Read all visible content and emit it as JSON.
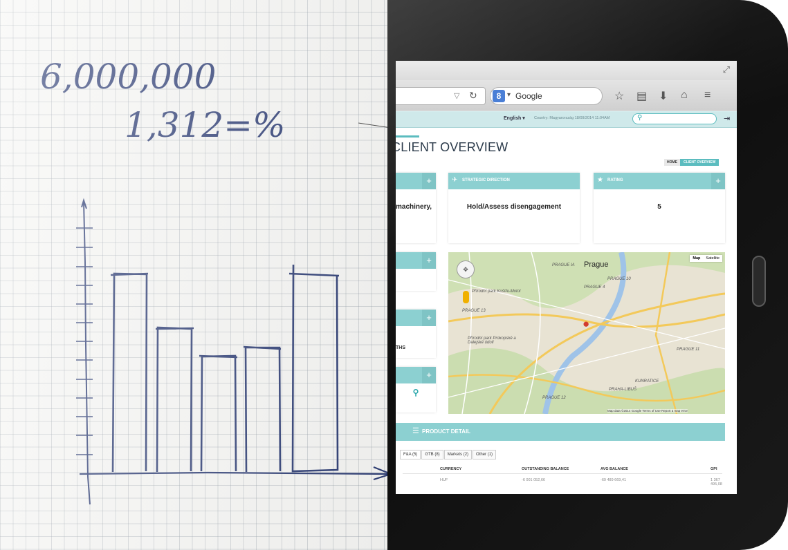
{
  "notebook": {
    "number": "6,000,000",
    "formula": "1,312=%"
  },
  "browser": {
    "search_engine": "Google"
  },
  "site": {
    "language": "English ▾",
    "country_info": "Country: Magyarország 18/09/2014 11:04AM",
    "page_title": "CLIENT OVERVIEW",
    "breadcrumb": {
      "home": "HOME",
      "current": "CLIENT OVERVIEW"
    },
    "cards": {
      "industry_value": "machinery,",
      "strategic_direction_title": "STRATEGIC DIRECTION",
      "strategic_direction_value": "Hold/Assess disengagement",
      "rating_title": "RATING",
      "rating_value": "5",
      "partial_value": "THS"
    },
    "map": {
      "city": "Prague",
      "btn_map": "Map",
      "btn_satellite": "Satellite",
      "footer": "Map data ©2014 Google  Terms of Use  Report a map error",
      "labels": {
        "praha_a": "PRAGUE 10",
        "praha_b": "PRAGUE 4",
        "praha_c": "PRAGUE 11",
        "praha_d": "PRAGUE 12",
        "praha_e": "PRAGUE 13",
        "kunratice": "KUNRATICE",
        "libus": "PRAHA-LIBUŠ",
        "park_a": "Přírodní park Košíře-Motol",
        "park_b": "Přírodní park Prokopské a Dalejské údolí",
        "pragueia": "PRAGUE IA"
      }
    },
    "product_detail": {
      "title": "PRODUCT DETAIL",
      "tabs": [
        "F&A (5)",
        "GTB (8)",
        "Markets (2)",
        "Other (1)"
      ],
      "columns": [
        "CURRENCY",
        "OUTSTANDING BALANCE",
        "AVG BALANCE",
        "GPI"
      ],
      "row": [
        "HUF",
        "-6 001 052,66",
        "-69 489 669,41",
        "1 367 495,08"
      ]
    }
  },
  "colors": {
    "accent": "#8cd0d1",
    "ink": "#2a3a72",
    "pin": "#d23c2f"
  }
}
